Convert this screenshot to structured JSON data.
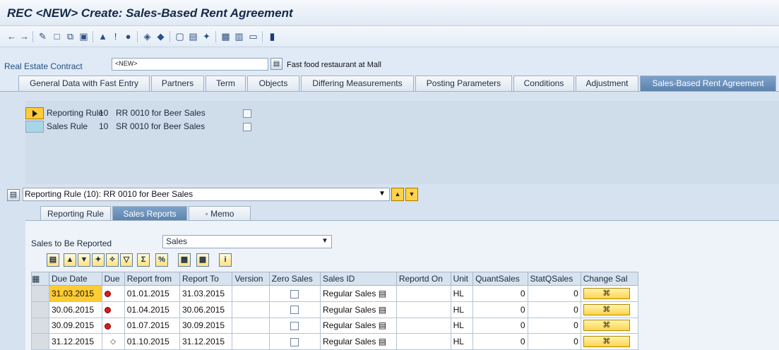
{
  "window": {
    "title": "REC <NEW> Create: Sales-Based Rent Agreement"
  },
  "toolbar": {
    "icons": [
      "back-icon",
      "forward-icon",
      "edit-icon",
      "create-icon",
      "copy-icon",
      "assign-icon",
      "other-object-icon",
      "info-icon",
      "display-icon",
      "save-variant-icon",
      "delete-icon",
      "print-icon",
      "document-icon",
      "find-icon",
      "partner-icon",
      "calendar-icon",
      "layout-icon",
      "help-icon"
    ]
  },
  "header": {
    "label": "Real Estate Contract",
    "contract_value": "<NEW>",
    "description": "Fast food restaurant at Mall"
  },
  "main_tabs": [
    {
      "label": "General Data with Fast Entry"
    },
    {
      "label": "Partners"
    },
    {
      "label": "Term"
    },
    {
      "label": "Objects"
    },
    {
      "label": "Differing Measurements"
    },
    {
      "label": "Posting Parameters"
    },
    {
      "label": "Conditions"
    },
    {
      "label": "Adjustment"
    },
    {
      "label": "Sales-Based Rent Agreement",
      "active": true
    }
  ],
  "rules": [
    {
      "name": "Reporting Rule",
      "number": "10",
      "description": "RR 0010 for Beer Sales",
      "checked": false
    },
    {
      "name": "Sales Rule",
      "number": "10",
      "description": "SR 0010 for Beer Sales",
      "checked": false
    }
  ],
  "selector": {
    "value": "Reporting Rule (10): RR 0010 for Beer Sales"
  },
  "sub_tabs": [
    {
      "label": "Reporting Rule"
    },
    {
      "label": "Sales Reports",
      "active": true
    },
    {
      "label": "◦ Memo"
    }
  ],
  "sales_to_report": {
    "label": "Sales to Be Reported",
    "value": "Sales"
  },
  "grid": {
    "columns": [
      "Due Date",
      "Due",
      "Report from",
      "Report To",
      "Version",
      "Zero Sales",
      "Sales ID",
      "Reportd On",
      "Unit",
      "QuantSales",
      "StatQSales",
      "Change Sal"
    ],
    "rows": [
      {
        "due_date": "31.03.2015",
        "due_status": "overdue",
        "from": "01.01.2015",
        "to": "31.03.2015",
        "version": "",
        "zero_sales": false,
        "sales_id": "Regular Sales",
        "reported_on": "",
        "unit": "HL",
        "quant": "0",
        "statq": "0"
      },
      {
        "due_date": "30.06.2015",
        "due_status": "overdue",
        "from": "01.04.2015",
        "to": "30.06.2015",
        "version": "",
        "zero_sales": false,
        "sales_id": "Regular Sales",
        "reported_on": "",
        "unit": "HL",
        "quant": "0",
        "statq": "0"
      },
      {
        "due_date": "30.09.2015",
        "due_status": "overdue",
        "from": "01.07.2015",
        "to": "30.09.2015",
        "version": "",
        "zero_sales": false,
        "sales_id": "Regular Sales",
        "reported_on": "",
        "unit": "HL",
        "quant": "0",
        "statq": "0"
      },
      {
        "due_date": "31.12.2015",
        "due_status": "open",
        "from": "01.10.2015",
        "to": "31.12.2015",
        "version": "",
        "zero_sales": false,
        "sales_id": "Regular Sales",
        "reported_on": "",
        "unit": "HL",
        "quant": "0",
        "statq": "0"
      }
    ]
  }
}
